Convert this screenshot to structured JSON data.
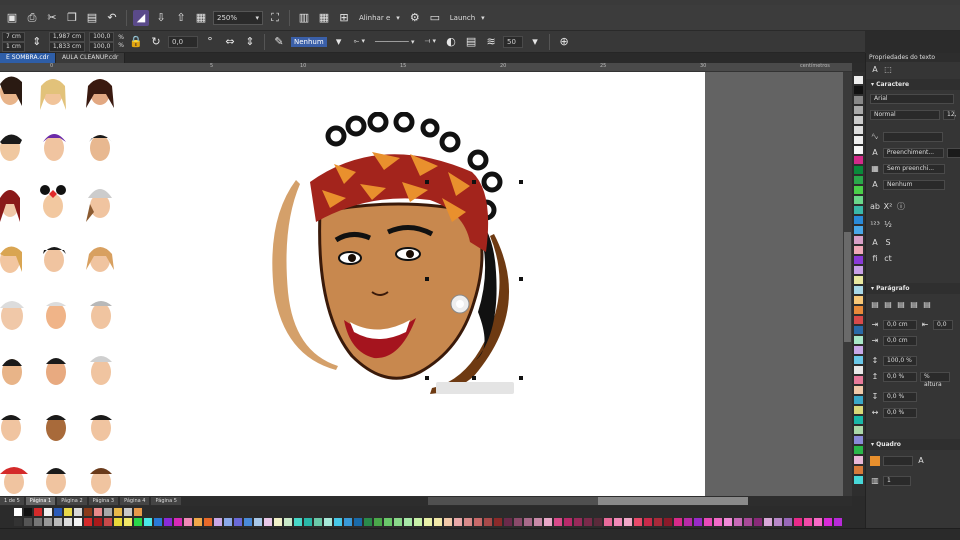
{
  "toolbar": {
    "zoom": "250%",
    "align_label": "Alinhar e",
    "launch_label": "Launch"
  },
  "propertybar": {
    "x": "7 cm",
    "y": "1 cm",
    "w": "1,987 cm",
    "h": "1,833 cm",
    "scale_x": "100,0",
    "scale_y": "100,0",
    "pct": "%",
    "angle": "0,0",
    "outline": "Nenhum",
    "fillet": "50"
  },
  "tabs": [
    {
      "label": "E SOMBRA.cdr"
    },
    {
      "label": "AULA CLEANUP.cdr"
    }
  ],
  "ruler_labels": [
    "0",
    "5",
    "10",
    "15",
    "20",
    "25",
    "30",
    "35",
    "40",
    "45"
  ],
  "ruler_unit": "centímetros",
  "page_nav": {
    "counter": "1 de 5",
    "pages": [
      "Página 1",
      "Página 2",
      "Página 3",
      "Página 4",
      "Página 5"
    ]
  },
  "docker": {
    "title": "Propriedades do texto",
    "character_header": "Caractere",
    "font": "Arial",
    "style": "Normal",
    "size": "12,",
    "fill_label": "Preenchiment...",
    "bg_label": "Sem preenchi...",
    "outline_label": "Nenhum",
    "paragraph_header": "Parágrafo",
    "indent1": "0,0 cm",
    "indent1b": "0,0",
    "indent2": "0,0 cm",
    "line_spacing": "100,0 %",
    "line_unit": "% altura",
    "before": "0,0 %",
    "after": "0,0 %",
    "char_spacing": "0,0 %",
    "frame_header": "Quadro",
    "columns": "1"
  },
  "colors": {
    "accent": "#2e5ea8",
    "bandana_red": "#a3241c",
    "bandana_orange": "#e9902d",
    "skin": "#c8884e",
    "bg_dark": "#2b2b2b"
  }
}
